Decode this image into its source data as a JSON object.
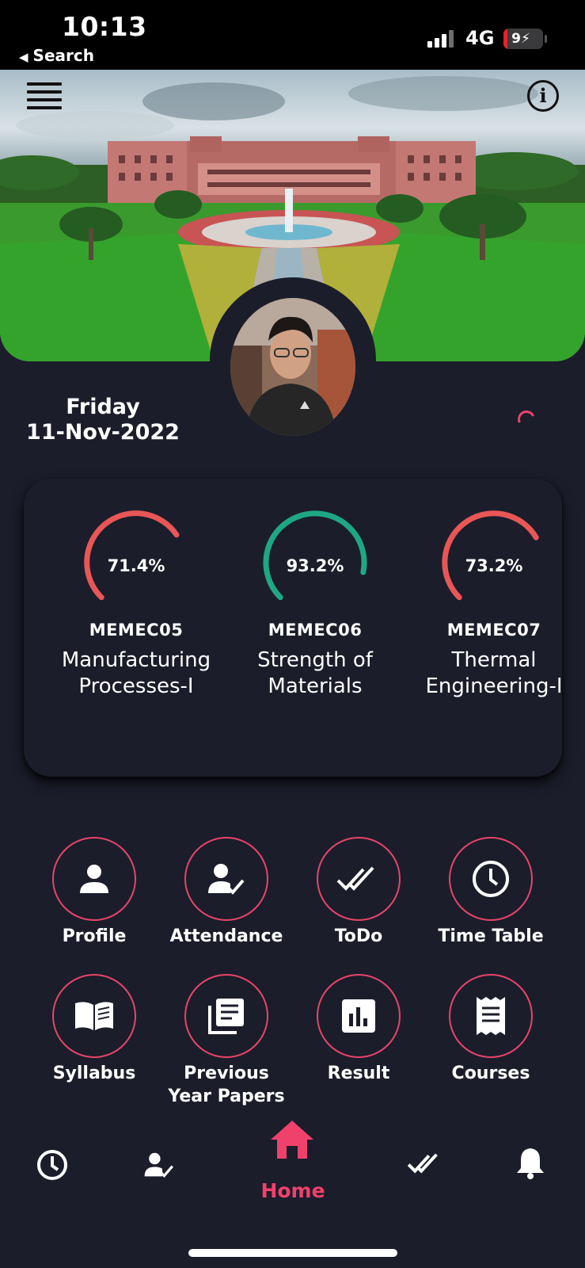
{
  "status_bar": {
    "time": "10:13",
    "back_label": "Search",
    "network": "4G",
    "battery": "9",
    "battery_level": 0.09
  },
  "header": {
    "menu_icon": "hamburger-menu-icon",
    "info_icon": "info-icon"
  },
  "date": {
    "day": "Friday",
    "full": "11-Nov-2022"
  },
  "colors": {
    "background": "#1b1d2b",
    "accent": "#f0416c",
    "gauge_red": "#e85656",
    "gauge_green": "#1fa784"
  },
  "subjects": [
    {
      "percent": "71.4%",
      "value": 71.4,
      "code": "MEMEC05",
      "name_line1": "Manufacturing",
      "name_line2": "Processes-I",
      "color": "#e85656"
    },
    {
      "percent": "93.2%",
      "value": 93.2,
      "code": "MEMEC06",
      "name_line1": "Strength of",
      "name_line2": "Materials",
      "color": "#1fa784"
    },
    {
      "percent": "73.2%",
      "value": 73.2,
      "code": "MEMEC07",
      "name_line1": "Thermal",
      "name_line2": "Engineering-I",
      "color": "#e85656"
    }
  ],
  "menu": [
    {
      "label_line1": "Profile",
      "label_line2": "",
      "icon": "person-icon"
    },
    {
      "label_line1": "Attendance",
      "label_line2": "",
      "icon": "person-check-icon"
    },
    {
      "label_line1": "ToDo",
      "label_line2": "",
      "icon": "double-check-icon"
    },
    {
      "label_line1": "Time Table",
      "label_line2": "",
      "icon": "clock-icon"
    },
    {
      "label_line1": "Syllabus",
      "label_line2": "",
      "icon": "open-book-icon"
    },
    {
      "label_line1": "Previous",
      "label_line2": "Year Papers",
      "icon": "documents-icon"
    },
    {
      "label_line1": "Result",
      "label_line2": "",
      "icon": "bar-chart-icon"
    },
    {
      "label_line1": "Courses",
      "label_line2": "",
      "icon": "receipt-icon"
    }
  ],
  "bottom_nav": {
    "active": "Home",
    "home_label": "Home",
    "items": [
      "clock-icon",
      "person-check-icon",
      "home-icon",
      "double-check-icon",
      "bell-icon"
    ]
  }
}
